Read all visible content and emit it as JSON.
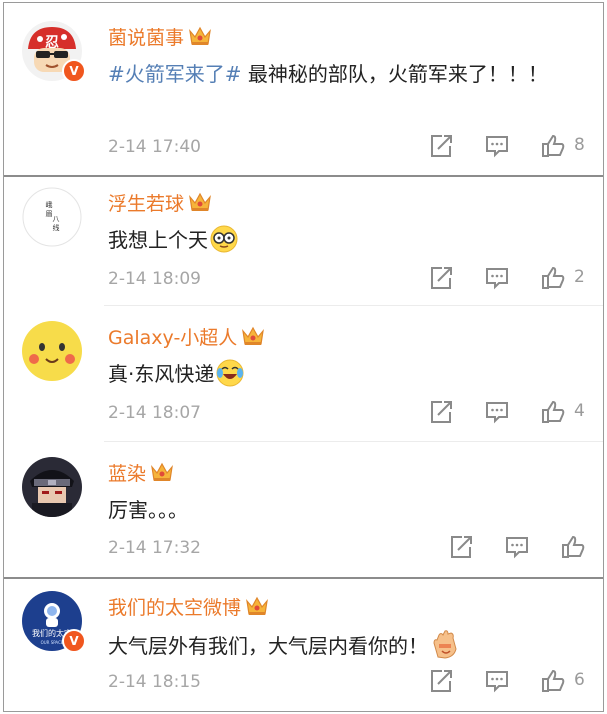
{
  "comments": [
    {
      "username": "菌说菌事",
      "hashtag": "#火箭军来了#",
      "text": " 最神秘的部队，火箭军来了！！！",
      "time": "2-14 17:40",
      "likes": "8",
      "avatar_icon": "mushroom-cartoon-avatar",
      "avatar_glyph": "忍",
      "verified": true
    },
    {
      "username": "浮生若球",
      "text": "我想上个天",
      "emoji": "nerd-glasses-emoji",
      "time": "2-14 18:09",
      "likes": "2",
      "avatar_icon": "calligraphy-avatar",
      "avatar_glyph": "峨\n眉\n八\n线",
      "verified": false
    },
    {
      "username": "Galaxy-小超人",
      "text": "真·东风快递",
      "emoji": "laugh-cry-emoji",
      "time": "2-14 18:07",
      "likes": "4",
      "avatar_icon": "pikachu-avatar",
      "verified": false
    },
    {
      "username": "蓝染",
      "text": "厉害。。。",
      "time": "2-14 17:32",
      "likes": "",
      "avatar_icon": "anime-character-avatar",
      "verified": false
    },
    {
      "username": "我们的太空微博",
      "text": "大气层外有我们，大气层内看你的！",
      "emoji": "clapping-hands-emoji",
      "time": "2-14 18:15",
      "likes": "6",
      "avatar_icon": "astronaut-logo-avatar",
      "avatar_glyph": "我们的太空",
      "avatar_subglyph": "OUR SPACE",
      "verified": true
    }
  ],
  "colors": {
    "username": "#eb7a2b",
    "hashtag": "#557fb5",
    "time": "#a6a6a6",
    "verified_badge": "#f0561e"
  }
}
